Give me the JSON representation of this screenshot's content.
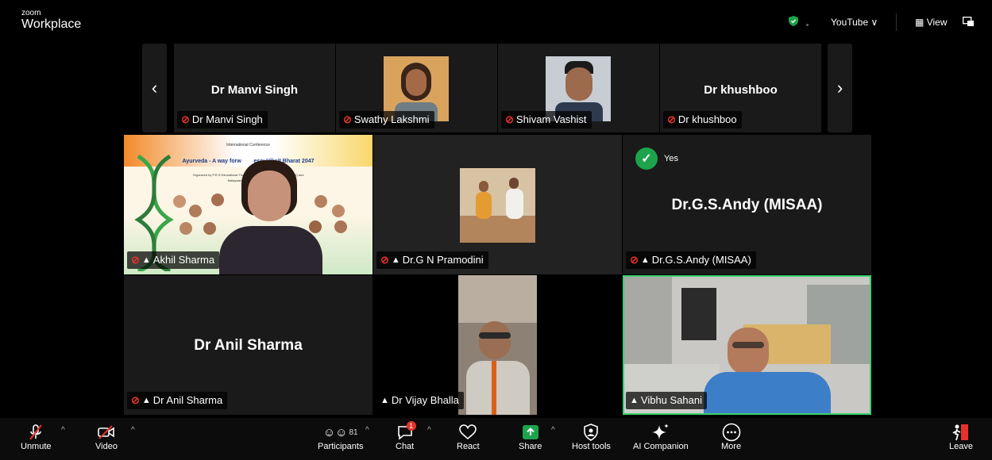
{
  "app": {
    "logo_top": "zoom",
    "logo_bottom": "Workplace"
  },
  "header": {
    "stream_label": "YouTube ∨",
    "view_label": "View"
  },
  "strip": [
    {
      "big_name": "Dr Manvi Singh",
      "tag": "Dr Manvi Singh",
      "muted": true
    },
    {
      "big_name": "",
      "tag": "Swathy Lakshmi",
      "muted": true
    },
    {
      "big_name": "",
      "tag": "Shivam Vashist",
      "muted": true
    },
    {
      "big_name": "Dr khushboo",
      "tag": "Dr khushboo",
      "muted": true
    }
  ],
  "grid": [
    {
      "tag": "Akhil Sharma",
      "muted": true,
      "pinned": true,
      "slide": {
        "line1": "International Conference",
        "line2": "Ayurveda - A way forw        ess: Viksit Bharat 2047",
        "line3": "Organized by P.R.S Educational Trust          Graduate's Association (IPGA) and",
        "line4": "Malaysian          tion (MISAA)"
      }
    },
    {
      "tag": "Dr.G N Pramodini",
      "muted": true,
      "pinned": true
    },
    {
      "big_name": "Dr.G.S.Andy (MISAA)",
      "tag": "Dr.G.S.Andy (MISAA)",
      "muted": true,
      "pinned": true,
      "reaction": "Yes"
    },
    {
      "big_name": "Dr Anil Sharma",
      "tag": "Dr Anil Sharma",
      "muted": true,
      "pinned": true
    },
    {
      "tag": "Dr Vijay Bhalla",
      "muted": false,
      "pinned": true
    },
    {
      "tag": "Vibhu Sahani",
      "muted": false,
      "pinned": true,
      "active_speaker": true
    }
  ],
  "toolbar": {
    "unmute": "Unmute",
    "video": "Video",
    "participants": "Participants",
    "participants_count": "81",
    "chat": "Chat",
    "chat_badge": "1",
    "react": "React",
    "share": "Share",
    "host_tools": "Host tools",
    "ai_companion": "AI Companion",
    "more": "More",
    "leave": "Leave"
  },
  "colors": {
    "accent_green": "#1ea34d",
    "muted_red": "#e8312b",
    "active_border": "#3bd16f",
    "share_green": "#1ea34d"
  }
}
